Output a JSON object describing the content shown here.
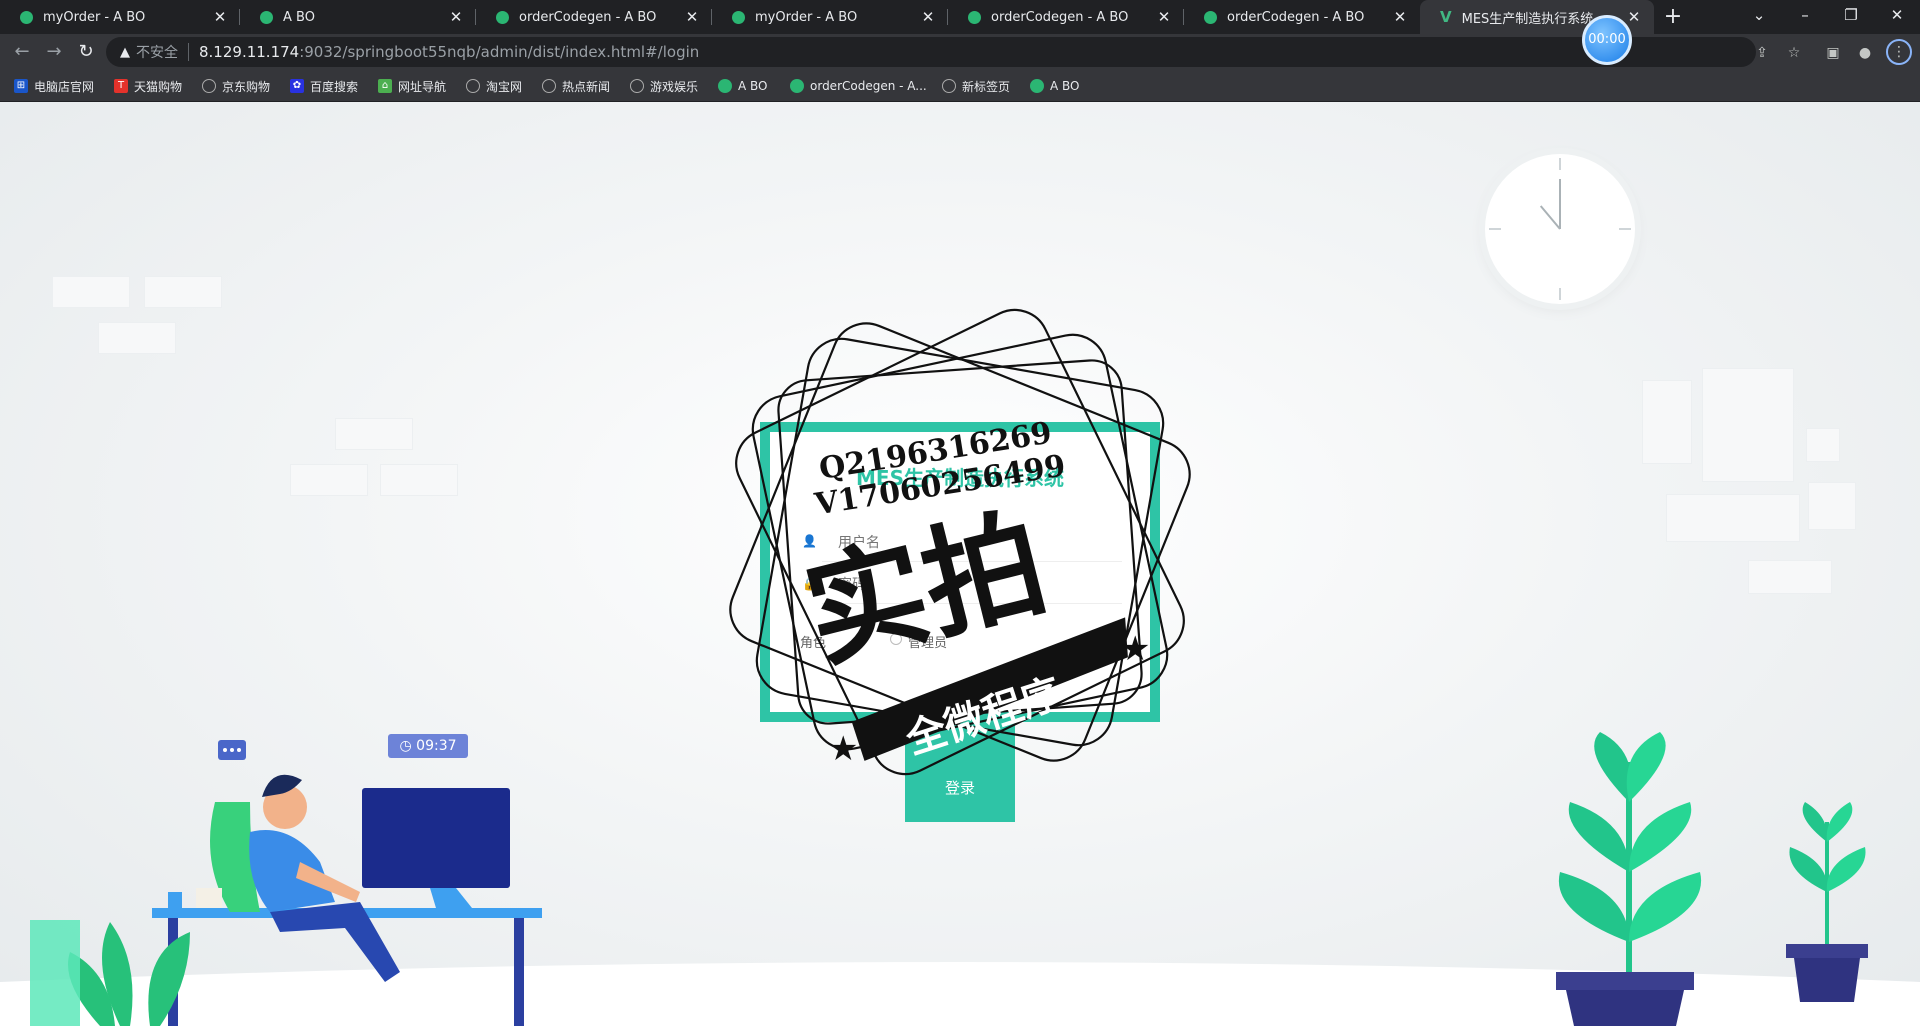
{
  "browser": {
    "tabs": [
      {
        "title": "myOrder - A BO"
      },
      {
        "title": "A BO"
      },
      {
        "title": "orderCodegen - A BO"
      },
      {
        "title": "myOrder - A BO"
      },
      {
        "title": "orderCodegen - A BO"
      },
      {
        "title": "orderCodegen - A BO"
      },
      {
        "title": "MES生产制造执行系统",
        "active": true
      }
    ],
    "timer": "00:00",
    "security_label": "不安全",
    "url_host": "8.129.11.174",
    "url_path": ":9032/springboot55nqb/admin/dist/index.html#/login",
    "bookmarks": [
      {
        "label": "电脑店官网",
        "icon": "computer-store-icon",
        "color": "#1a56c9"
      },
      {
        "label": "天猫购物",
        "icon": "tmall-icon",
        "color": "#e4322b"
      },
      {
        "label": "京东购物",
        "icon": "globe-icon",
        "color": "#777777"
      },
      {
        "label": "百度搜索",
        "icon": "baidu-icon",
        "color": "#2932e1"
      },
      {
        "label": "网址导航",
        "icon": "home-icon",
        "color": "#4caf50"
      },
      {
        "label": "淘宝网",
        "icon": "globe-icon",
        "color": "#777777"
      },
      {
        "label": "热点新闻",
        "icon": "globe-icon",
        "color": "#777777"
      },
      {
        "label": "游戏娱乐",
        "icon": "globe-icon",
        "color": "#777777"
      },
      {
        "label": "A BO",
        "icon": "abo-icon",
        "color": "#2bb673"
      },
      {
        "label": "orderCodegen - A...",
        "icon": "abo-icon",
        "color": "#2bb673"
      },
      {
        "label": "新标签页",
        "icon": "globe-icon",
        "color": "#777777"
      },
      {
        "label": "A BO",
        "icon": "abo-icon",
        "color": "#2bb673"
      }
    ]
  },
  "login": {
    "title": "MES生产制造执行系统",
    "username_placeholder": "用户名",
    "password_placeholder": "密码",
    "role_label": "角色",
    "role_option": "管理员",
    "submit_label": "登录"
  },
  "watermark": {
    "line1": "Q2196316269",
    "line2": "V17060256499",
    "main": "实拍",
    "banner": "全微程序"
  },
  "illustration": {
    "time_badge": "09:37"
  },
  "colors": {
    "accent": "#2ec4a6",
    "plant": "#22c58b",
    "pot": "#3b3f8f"
  }
}
